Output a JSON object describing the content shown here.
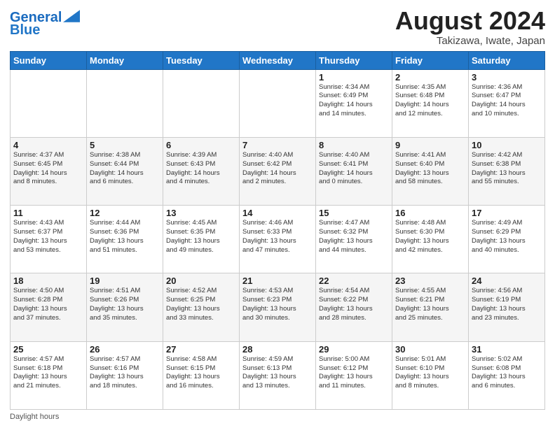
{
  "header": {
    "logo_line1": "General",
    "logo_line2": "Blue",
    "main_title": "August 2024",
    "subtitle": "Takizawa, Iwate, Japan"
  },
  "days_of_week": [
    "Sunday",
    "Monday",
    "Tuesday",
    "Wednesday",
    "Thursday",
    "Friday",
    "Saturday"
  ],
  "weeks": [
    [
      {
        "day": "",
        "info": ""
      },
      {
        "day": "",
        "info": ""
      },
      {
        "day": "",
        "info": ""
      },
      {
        "day": "",
        "info": ""
      },
      {
        "day": "1",
        "info": "Sunrise: 4:34 AM\nSunset: 6:49 PM\nDaylight: 14 hours\nand 14 minutes."
      },
      {
        "day": "2",
        "info": "Sunrise: 4:35 AM\nSunset: 6:48 PM\nDaylight: 14 hours\nand 12 minutes."
      },
      {
        "day": "3",
        "info": "Sunrise: 4:36 AM\nSunset: 6:47 PM\nDaylight: 14 hours\nand 10 minutes."
      }
    ],
    [
      {
        "day": "4",
        "info": "Sunrise: 4:37 AM\nSunset: 6:45 PM\nDaylight: 14 hours\nand 8 minutes."
      },
      {
        "day": "5",
        "info": "Sunrise: 4:38 AM\nSunset: 6:44 PM\nDaylight: 14 hours\nand 6 minutes."
      },
      {
        "day": "6",
        "info": "Sunrise: 4:39 AM\nSunset: 6:43 PM\nDaylight: 14 hours\nand 4 minutes."
      },
      {
        "day": "7",
        "info": "Sunrise: 4:40 AM\nSunset: 6:42 PM\nDaylight: 14 hours\nand 2 minutes."
      },
      {
        "day": "8",
        "info": "Sunrise: 4:40 AM\nSunset: 6:41 PM\nDaylight: 14 hours\nand 0 minutes."
      },
      {
        "day": "9",
        "info": "Sunrise: 4:41 AM\nSunset: 6:40 PM\nDaylight: 13 hours\nand 58 minutes."
      },
      {
        "day": "10",
        "info": "Sunrise: 4:42 AM\nSunset: 6:38 PM\nDaylight: 13 hours\nand 55 minutes."
      }
    ],
    [
      {
        "day": "11",
        "info": "Sunrise: 4:43 AM\nSunset: 6:37 PM\nDaylight: 13 hours\nand 53 minutes."
      },
      {
        "day": "12",
        "info": "Sunrise: 4:44 AM\nSunset: 6:36 PM\nDaylight: 13 hours\nand 51 minutes."
      },
      {
        "day": "13",
        "info": "Sunrise: 4:45 AM\nSunset: 6:35 PM\nDaylight: 13 hours\nand 49 minutes."
      },
      {
        "day": "14",
        "info": "Sunrise: 4:46 AM\nSunset: 6:33 PM\nDaylight: 13 hours\nand 47 minutes."
      },
      {
        "day": "15",
        "info": "Sunrise: 4:47 AM\nSunset: 6:32 PM\nDaylight: 13 hours\nand 44 minutes."
      },
      {
        "day": "16",
        "info": "Sunrise: 4:48 AM\nSunset: 6:30 PM\nDaylight: 13 hours\nand 42 minutes."
      },
      {
        "day": "17",
        "info": "Sunrise: 4:49 AM\nSunset: 6:29 PM\nDaylight: 13 hours\nand 40 minutes."
      }
    ],
    [
      {
        "day": "18",
        "info": "Sunrise: 4:50 AM\nSunset: 6:28 PM\nDaylight: 13 hours\nand 37 minutes."
      },
      {
        "day": "19",
        "info": "Sunrise: 4:51 AM\nSunset: 6:26 PM\nDaylight: 13 hours\nand 35 minutes."
      },
      {
        "day": "20",
        "info": "Sunrise: 4:52 AM\nSunset: 6:25 PM\nDaylight: 13 hours\nand 33 minutes."
      },
      {
        "day": "21",
        "info": "Sunrise: 4:53 AM\nSunset: 6:23 PM\nDaylight: 13 hours\nand 30 minutes."
      },
      {
        "day": "22",
        "info": "Sunrise: 4:54 AM\nSunset: 6:22 PM\nDaylight: 13 hours\nand 28 minutes."
      },
      {
        "day": "23",
        "info": "Sunrise: 4:55 AM\nSunset: 6:21 PM\nDaylight: 13 hours\nand 25 minutes."
      },
      {
        "day": "24",
        "info": "Sunrise: 4:56 AM\nSunset: 6:19 PM\nDaylight: 13 hours\nand 23 minutes."
      }
    ],
    [
      {
        "day": "25",
        "info": "Sunrise: 4:57 AM\nSunset: 6:18 PM\nDaylight: 13 hours\nand 21 minutes."
      },
      {
        "day": "26",
        "info": "Sunrise: 4:57 AM\nSunset: 6:16 PM\nDaylight: 13 hours\nand 18 minutes."
      },
      {
        "day": "27",
        "info": "Sunrise: 4:58 AM\nSunset: 6:15 PM\nDaylight: 13 hours\nand 16 minutes."
      },
      {
        "day": "28",
        "info": "Sunrise: 4:59 AM\nSunset: 6:13 PM\nDaylight: 13 hours\nand 13 minutes."
      },
      {
        "day": "29",
        "info": "Sunrise: 5:00 AM\nSunset: 6:12 PM\nDaylight: 13 hours\nand 11 minutes."
      },
      {
        "day": "30",
        "info": "Sunrise: 5:01 AM\nSunset: 6:10 PM\nDaylight: 13 hours\nand 8 minutes."
      },
      {
        "day": "31",
        "info": "Sunrise: 5:02 AM\nSunset: 6:08 PM\nDaylight: 13 hours\nand 6 minutes."
      }
    ]
  ],
  "footer": {
    "note": "Daylight hours"
  }
}
